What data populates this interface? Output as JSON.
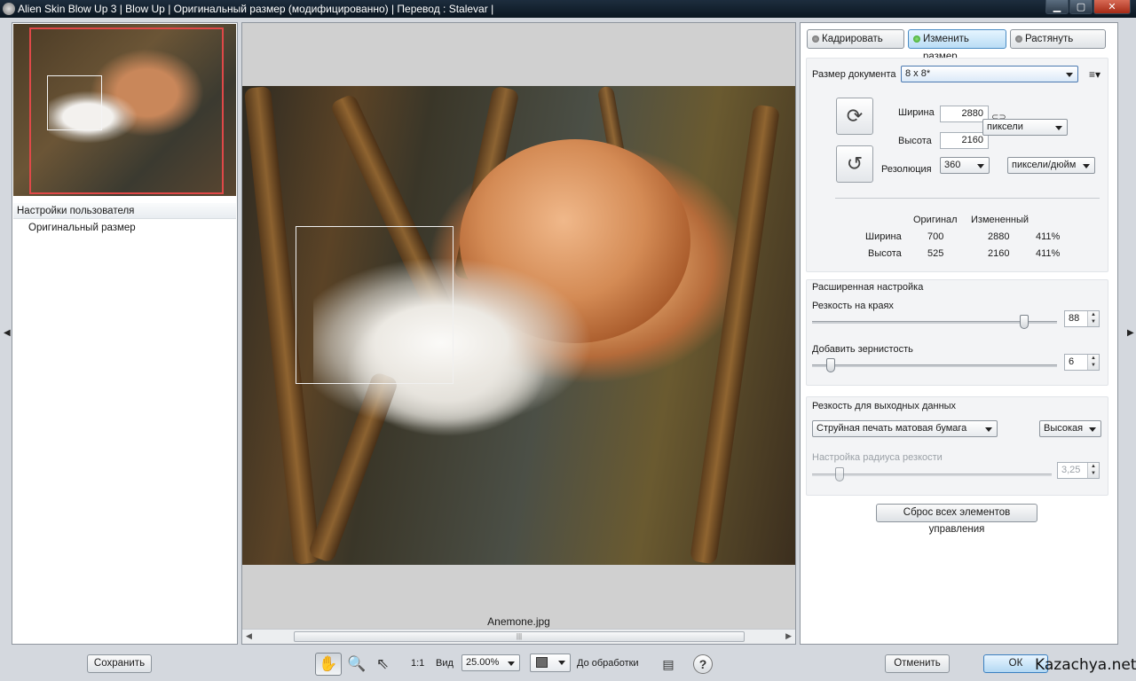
{
  "window": {
    "title": "Alien Skin Blow Up 3 | Blow Up | Оригинальный размер (модифицированно) | Перевод : Stalevar |",
    "minimize": "▁",
    "maximize": "▢",
    "close": "✕"
  },
  "presets": {
    "header": "Настройки пользователя",
    "items": [
      "Оригинальный размер"
    ]
  },
  "preview": {
    "filename": "Anemone.jpg",
    "scroll_grip": "|||"
  },
  "tabs": {
    "crop": "Кадрировать",
    "resize": "Изменить размер",
    "stretch": "Растянуть"
  },
  "document": {
    "size_label": "Размер документа",
    "size_value": "8 x 8*",
    "menu_icon": "≡▾",
    "width_label": "Ширина",
    "width_value": "2880",
    "height_label": "Высота",
    "height_value": "2160",
    "unit_value": "пиксели",
    "resolution_label": "Резолюция",
    "resolution_value": "360",
    "resolution_unit": "пиксели/дюйм"
  },
  "comparison": {
    "col_original": "Оригинал",
    "col_modified": "Измененный",
    "rows": [
      {
        "label": "Ширина",
        "original": "700",
        "modified": "2880",
        "percent": "411%"
      },
      {
        "label": "Высота",
        "original": "525",
        "modified": "2160",
        "percent": "411%"
      }
    ]
  },
  "advanced": {
    "title": "Расширенная настройка",
    "edge_sharpness_label": "Резкость на краях",
    "edge_sharpness_value": "88",
    "edge_sharpness_fraction": 0.88,
    "grain_label": "Добавить зернистость",
    "grain_value": "6",
    "grain_fraction": 0.06
  },
  "output": {
    "title": "Резкость для выходных данных",
    "printer_value": "Струйная печать матовая бумага",
    "quality_value": "Высокая",
    "radius_label": "Настройка радиуса резкости",
    "radius_value": "3,25",
    "radius_fraction": 0.1
  },
  "reset_label": "Сброс всех элементов управления",
  "bottom": {
    "save_label": "Сохранить",
    "one_to_one": "1:1",
    "view_label": "Вид",
    "zoom_value": "25.00%",
    "before_label": "До обработки",
    "cancel_label": "Отменить",
    "ok_label": "ОК",
    "help_icon": "?"
  },
  "watermark": "Kazachya.net"
}
